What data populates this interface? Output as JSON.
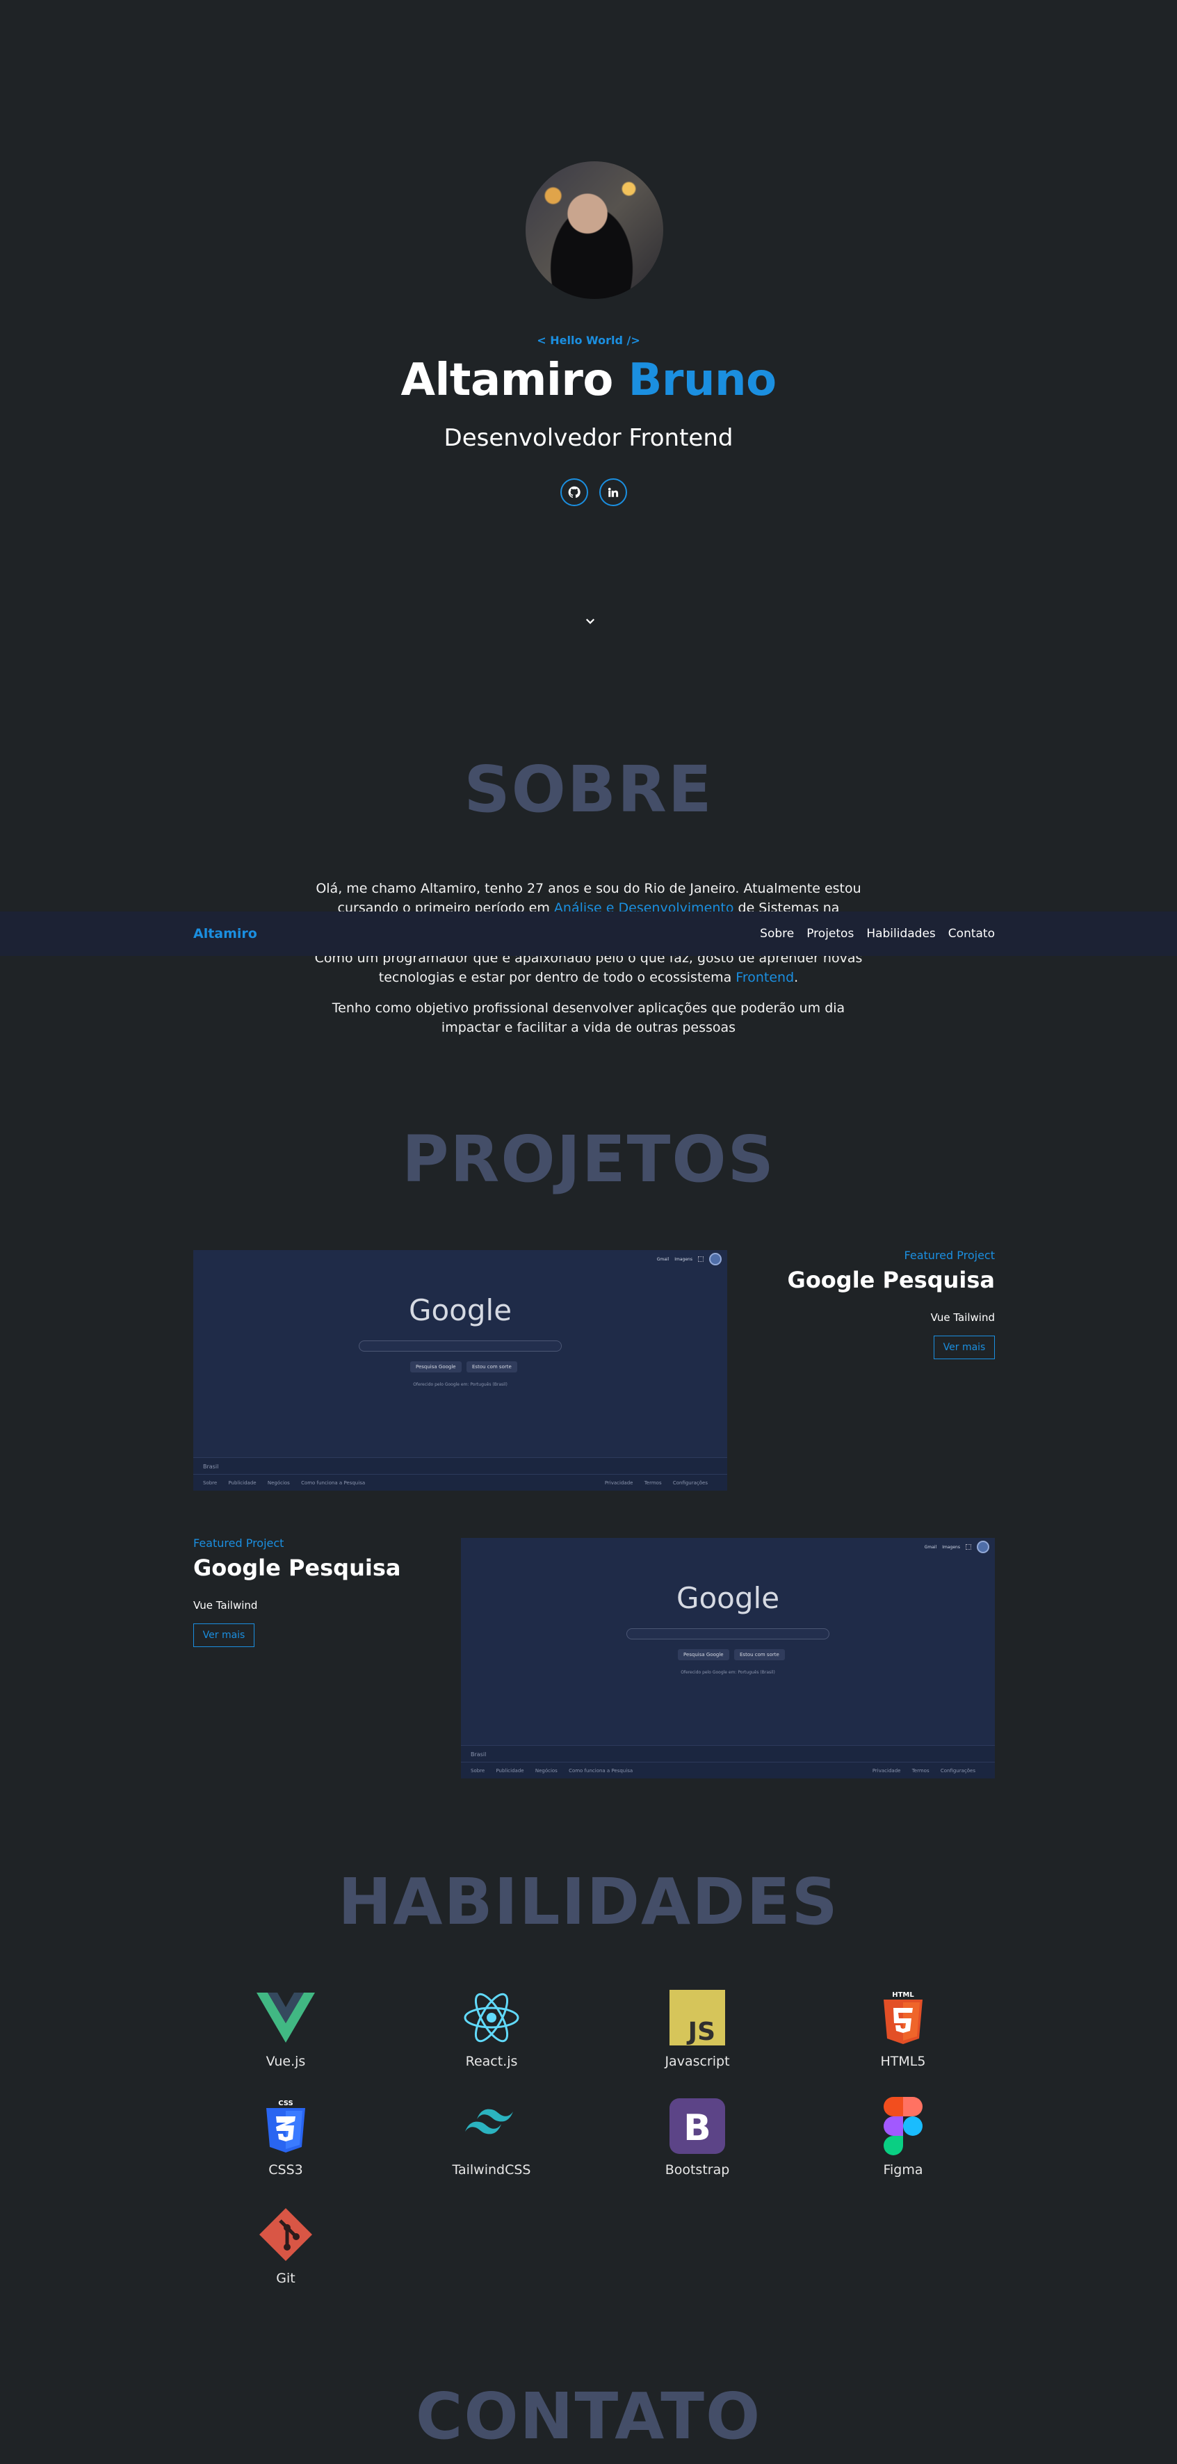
{
  "hero": {
    "greeting": "< Hello World />",
    "first_name": "Altamiro",
    "last_name": "Bruno",
    "role": "Desenvolvedor Frontend",
    "socials": [
      {
        "icon": "github-icon"
      },
      {
        "icon": "linkedin-icon"
      }
    ],
    "scroll_icon": "chevron-down-icon"
  },
  "navbar": {
    "brand": "Altamiro",
    "links": [
      "Sobre",
      "Projetos",
      "Habilidades",
      "Contato"
    ]
  },
  "about": {
    "title": "SOBRE",
    "p1_a": "Olá, me chamo Altamiro, tenho 27 anos e sou do Rio de Janeiro. Atualmente estou cursando o primeiro período em ",
    "p1_hl": "Análise e Desenvolvimento",
    "p1_b": " de Sistemas na Faculdade",
    "p2_a": "Como um programador que é apaixonado pelo o que faz, gosto de aprender novas tecnologias e estar por dentro de todo o ecossistema ",
    "p2_hl": "Frontend",
    "p2_b": ".",
    "p3": "Tenho como objetivo profissional desenvolver aplicações que poderão um dia impactar e facilitar a vida de outras pessoas"
  },
  "projects": {
    "title": "PROJETOS",
    "items": [
      {
        "featured": "Featured Project",
        "name": "Google Pesquisa",
        "tags": "Vue  Tailwind",
        "button": "Ver mais",
        "screenshot": {
          "top_links": [
            "Gmail",
            "Imagens"
          ],
          "logo": "Google",
          "buttons": [
            "Pesquisa Google",
            "Estou com sorte"
          ],
          "offer": "Oferecido pelo Google em: Português (Brasil)",
          "country": "Brasil",
          "footer_left": [
            "Sobre",
            "Publicidade",
            "Negócios",
            "Como funciona a Pesquisa"
          ],
          "footer_right": [
            "Privacidade",
            "Termos",
            "Configurações"
          ]
        }
      },
      {
        "featured": "Featured Project",
        "name": "Google Pesquisa",
        "tags": "Vue  Tailwind",
        "button": "Ver mais",
        "screenshot": {
          "top_links": [
            "Gmail",
            "Imagens"
          ],
          "logo": "Google",
          "buttons": [
            "Pesquisa Google",
            "Estou com sorte"
          ],
          "offer": "Oferecido pelo Google em: Português (Brasil)",
          "country": "Brasil",
          "footer_left": [
            "Sobre",
            "Publicidade",
            "Negócios",
            "Como funciona a Pesquisa"
          ],
          "footer_right": [
            "Privacidade",
            "Termos",
            "Configurações"
          ]
        }
      }
    ]
  },
  "skills": {
    "title": "HABILIDADES",
    "items": [
      {
        "label": "Vue.js",
        "icon": "vue-icon",
        "color": "#41b883"
      },
      {
        "label": "React.js",
        "icon": "react-icon",
        "color": "#61dafb"
      },
      {
        "label": "Javascript",
        "icon": "javascript-icon",
        "color": "#d6c55a"
      },
      {
        "label": "HTML5",
        "icon": "html5-icon",
        "color": "#e34f26"
      },
      {
        "label": "CSS3",
        "icon": "css3-icon",
        "color": "#2965f1"
      },
      {
        "label": "TailwindCSS",
        "icon": "tailwind-icon",
        "color": "#2bb3c0"
      },
      {
        "label": "Bootstrap",
        "icon": "bootstrap-icon",
        "color": "#5c4487"
      },
      {
        "label": "Figma",
        "icon": "figma-icon",
        "color": "#f24e1e"
      },
      {
        "label": "Git",
        "icon": "git-icon",
        "color": "#d95645"
      }
    ]
  },
  "contact": {
    "title": "CONTATO"
  },
  "colors": {
    "background": "#1f2326",
    "accent": "#1b8fe0",
    "section_title": "#444e68",
    "navbar": "#1c2234"
  }
}
